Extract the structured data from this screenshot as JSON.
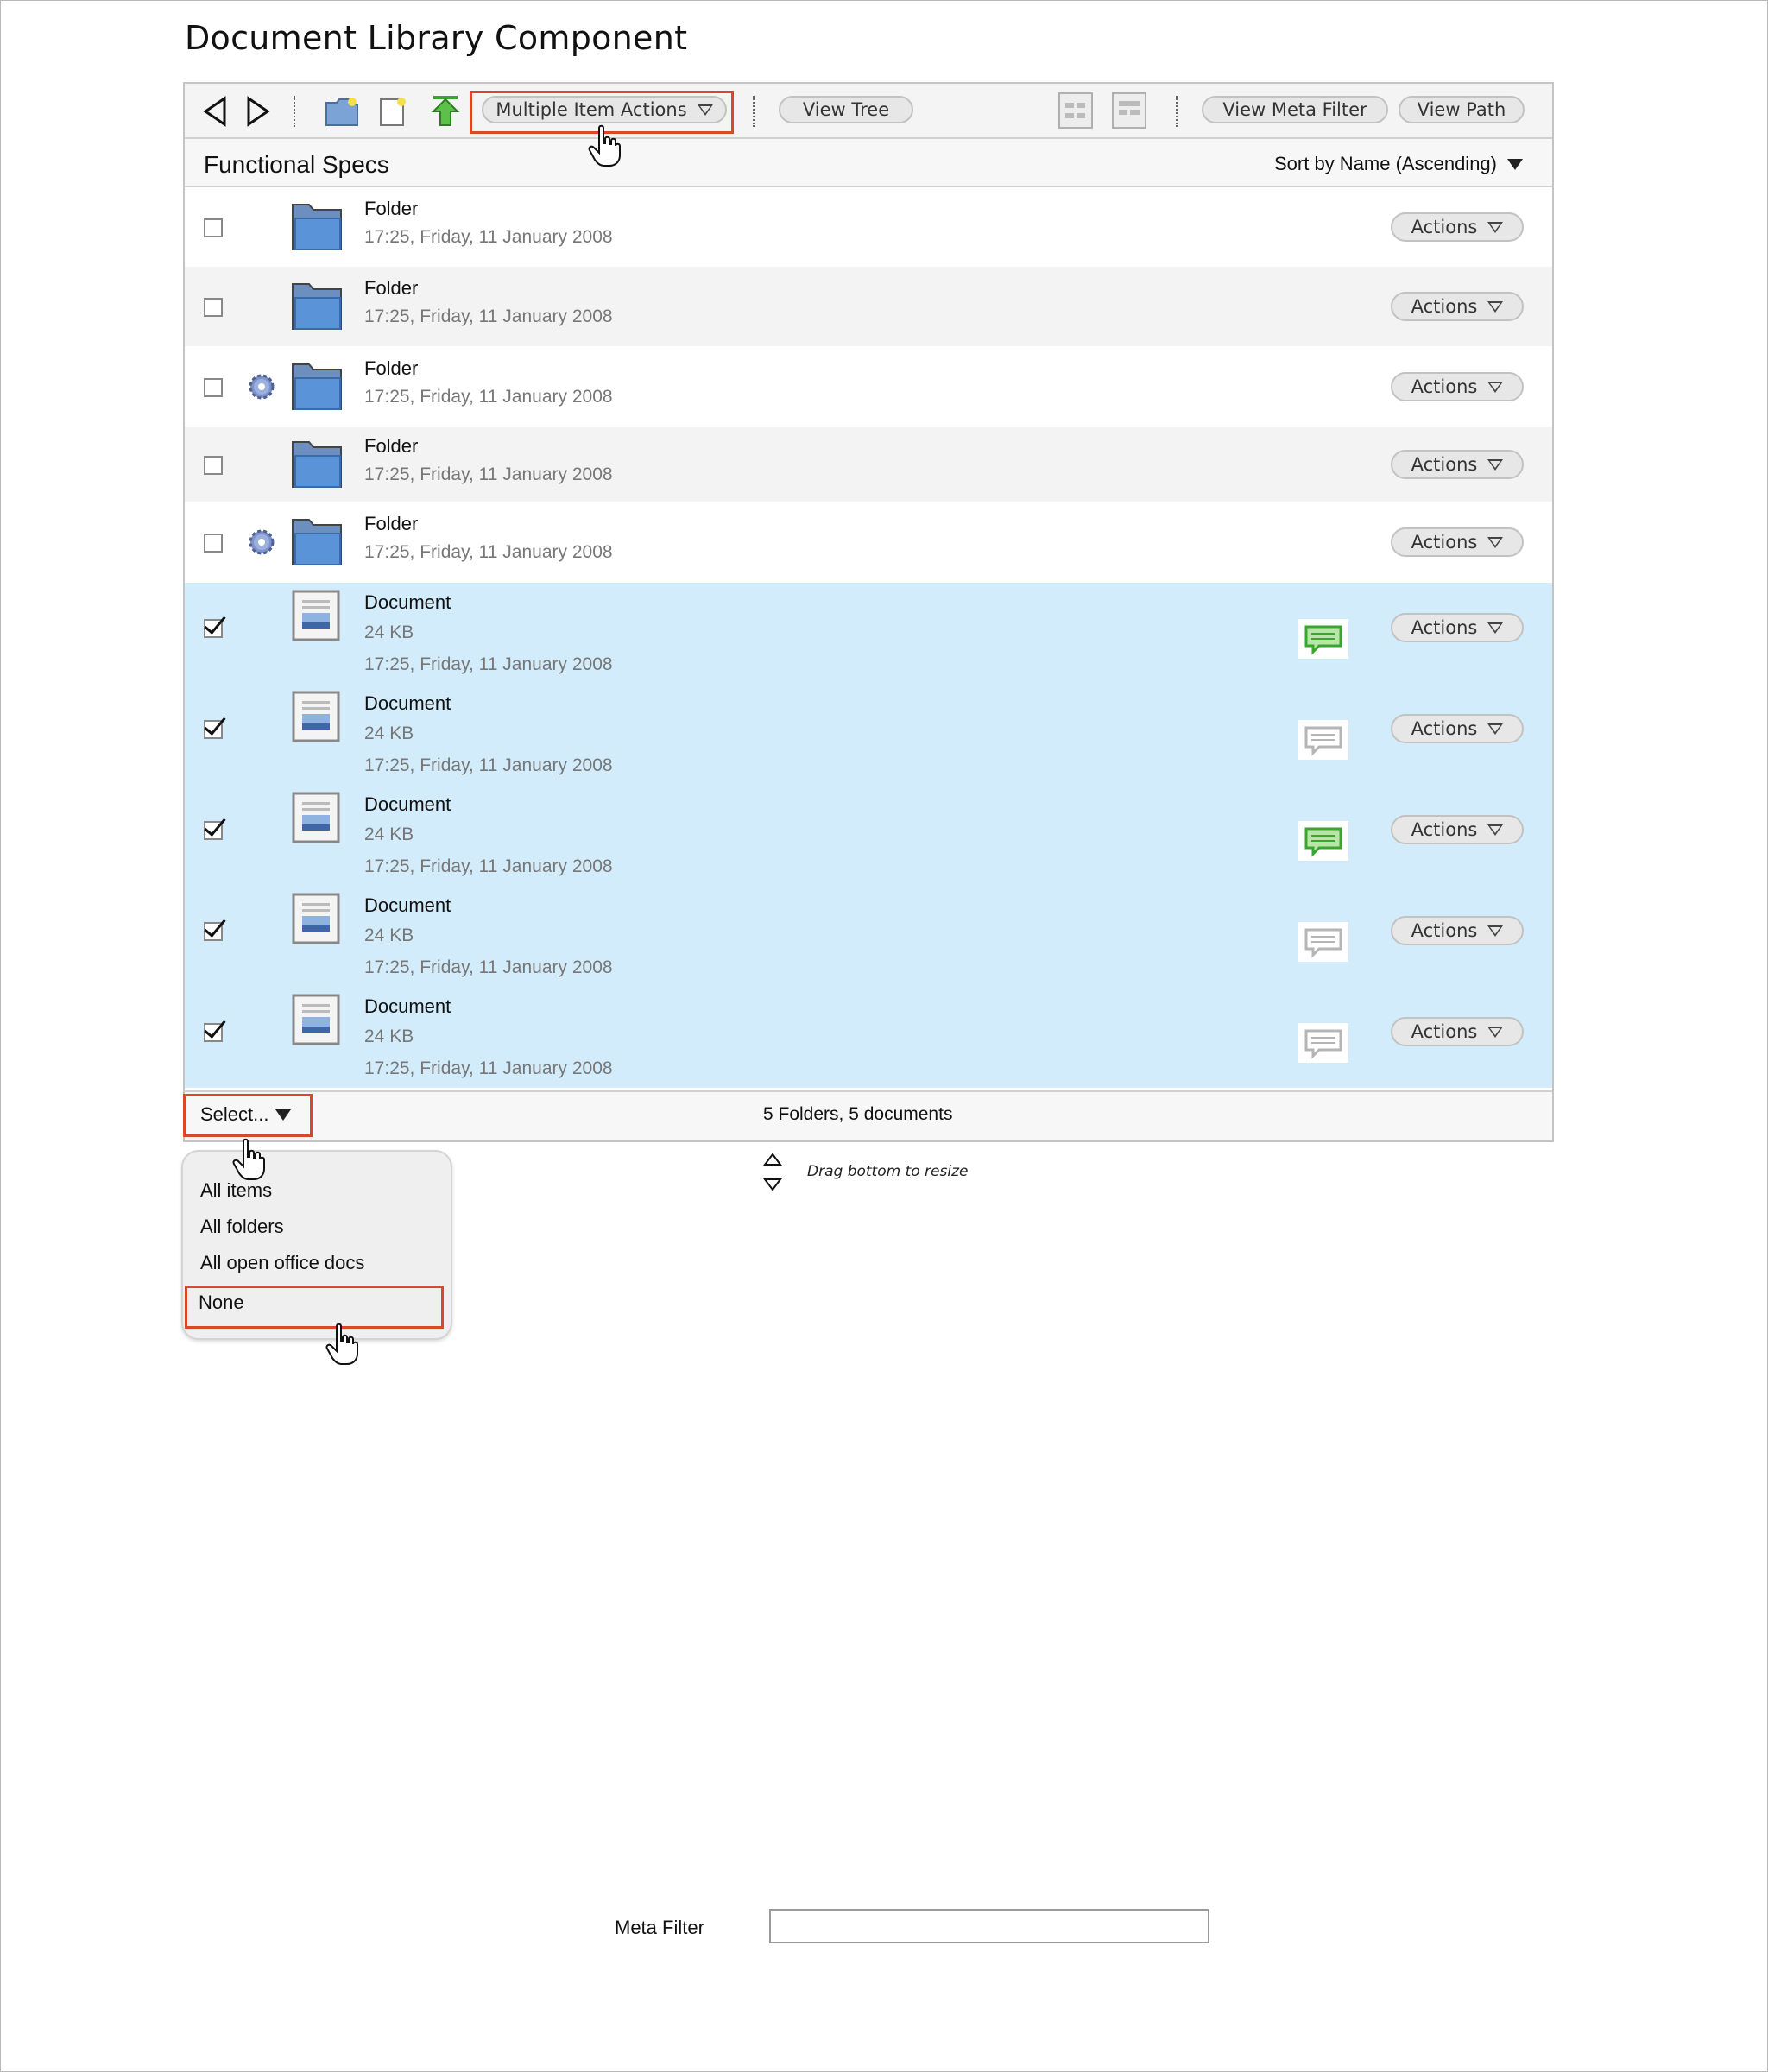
{
  "page": {
    "title": "Document Library Component"
  },
  "toolbar": {
    "back_icon": "back-arrow-icon",
    "forward_icon": "forward-arrow-icon",
    "new_folder_icon": "new-folder-icon",
    "new_document_icon": "new-document-icon",
    "upload_icon": "upload-icon",
    "multiple_item_actions_label": "Multiple Item Actions",
    "view_tree_label": "View Tree",
    "view_meta_filter_label": "View Meta Filter",
    "view_path_label": "View Path"
  },
  "breadcrumb": {
    "title": "Functional Specs",
    "sort_label": "Sort by Name (Ascending)"
  },
  "colors": {
    "accent_highlight": "#d9482a",
    "selected_row": "#d3ecfb",
    "folder_blue": "#4f86cf",
    "comment_green": "#3aa52f"
  },
  "items": [
    {
      "type": "folder",
      "name": "Folder",
      "date": "17:25, Friday, 11 January 2008",
      "checked": false,
      "gear": false,
      "actions_label": "Actions"
    },
    {
      "type": "folder",
      "name": "Folder",
      "date": "17:25, Friday, 11 January 2008",
      "checked": false,
      "gear": false,
      "actions_label": "Actions"
    },
    {
      "type": "folder",
      "name": "Folder",
      "date": "17:25, Friday, 11 January 2008",
      "checked": false,
      "gear": true,
      "actions_label": "Actions"
    },
    {
      "type": "folder",
      "name": "Folder",
      "date": "17:25, Friday, 11 January 2008",
      "checked": false,
      "gear": false,
      "actions_label": "Actions"
    },
    {
      "type": "folder",
      "name": "Folder",
      "date": "17:25, Friday, 11 January 2008",
      "checked": false,
      "gear": true,
      "actions_label": "Actions"
    },
    {
      "type": "document",
      "name": "Document",
      "size": "24 KB",
      "date": "17:25, Friday, 11 January 2008",
      "checked": true,
      "comment_active": true,
      "actions_label": "Actions"
    },
    {
      "type": "document",
      "name": "Document",
      "size": "24 KB",
      "date": "17:25, Friday, 11 January 2008",
      "checked": true,
      "comment_active": false,
      "actions_label": "Actions"
    },
    {
      "type": "document",
      "name": "Document",
      "size": "24 KB",
      "date": "17:25, Friday, 11 January 2008",
      "checked": true,
      "comment_active": true,
      "actions_label": "Actions"
    },
    {
      "type": "document",
      "name": "Document",
      "size": "24 KB",
      "date": "17:25, Friday, 11 January 2008",
      "checked": true,
      "comment_active": false,
      "actions_label": "Actions"
    },
    {
      "type": "document",
      "name": "Document",
      "size": "24 KB",
      "date": "17:25, Friday, 11 January 2008",
      "checked": true,
      "comment_active": false,
      "actions_label": "Actions"
    }
  ],
  "footer": {
    "select_label": "Select...",
    "count_label": "5 Folders, 5 documents"
  },
  "select_menu": {
    "options": [
      "All items",
      "All folders",
      "All open office docs",
      "None"
    ]
  },
  "resize_hint": "Drag bottom to resize",
  "meta_filter": {
    "label": "Meta Filter",
    "value": ""
  }
}
